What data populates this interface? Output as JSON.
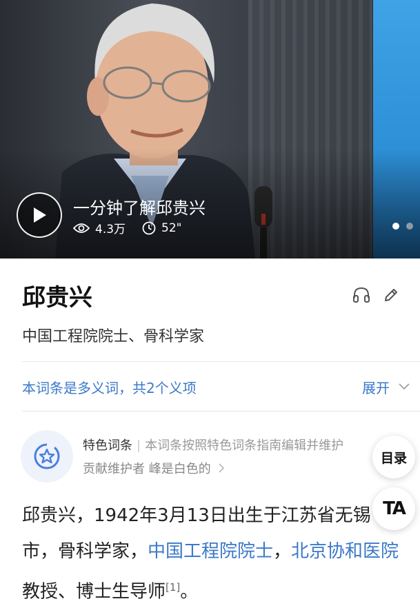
{
  "video": {
    "title": "一分钟了解邱贵兴",
    "views": "4.3万",
    "duration": "52\"",
    "slide_count": 2,
    "active_slide": 0
  },
  "entry": {
    "title": "邱贵兴",
    "subtitle": "中国工程院院士、骨科学家"
  },
  "polysemy": {
    "text": "本词条是多义词，共2个义项",
    "expand_label": "展开"
  },
  "featured": {
    "label": "特色词条",
    "description": "本词条按照特色词条指南编辑并维护",
    "maintainer": "贡献维护者 峰是白色的"
  },
  "floating": {
    "toc_label": "目录",
    "ta_label": "TA"
  },
  "summary": {
    "line_text_1": "邱贵兴，1942年3月13日出生于江苏省无锡",
    "line_text_2": "市，骨科学家，",
    "link_academician": "中国工程院院士",
    "comma": "，",
    "link_hospital": "北京协和医院",
    "tail": "教授、博士生导师",
    "ref": "[1]",
    "end": "。"
  },
  "colors": {
    "link": "#3b78c9",
    "accent_badge": "#4a7de0",
    "dot_active": "#ffffff",
    "dot_inactive": "#8f9aa6"
  }
}
